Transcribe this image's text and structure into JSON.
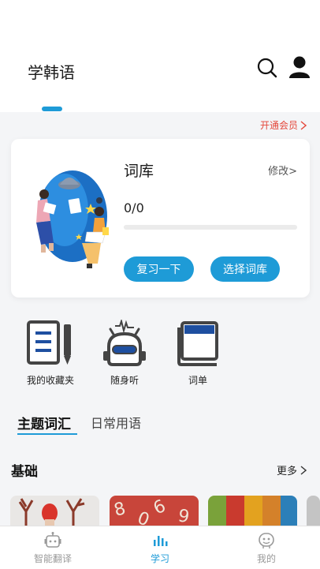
{
  "header": {
    "title": "学韩语",
    "search_icon": "search-icon",
    "user_icon": "user-icon"
  },
  "vip": {
    "label": "开通会员"
  },
  "wordbook": {
    "title": "词库",
    "edit_label": "修改>",
    "progress_text": "0/0",
    "progress_fraction": 0,
    "review_button": "复习一下",
    "select_button": "选择词库"
  },
  "quick_actions": [
    {
      "label": "我的收藏夹",
      "icon": "notebook-pencil-icon"
    },
    {
      "label": "随身听",
      "icon": "robot-radio-icon"
    },
    {
      "label": "词单",
      "icon": "book-icon"
    }
  ],
  "category_tabs": [
    {
      "label": "主题词汇",
      "active": true
    },
    {
      "label": "日常用语",
      "active": false
    }
  ],
  "section": {
    "title": "基础",
    "more_label": "更多"
  },
  "bottom_nav": [
    {
      "label": "智能翻译",
      "icon": "robot-icon",
      "active": false
    },
    {
      "label": "学习",
      "icon": "bars-icon",
      "active": true
    },
    {
      "label": "我的",
      "icon": "smiley-icon",
      "active": false
    }
  ],
  "colors": {
    "accent": "#1e9bd7",
    "vip": "#e4473b",
    "background": "#f4f5f7"
  }
}
